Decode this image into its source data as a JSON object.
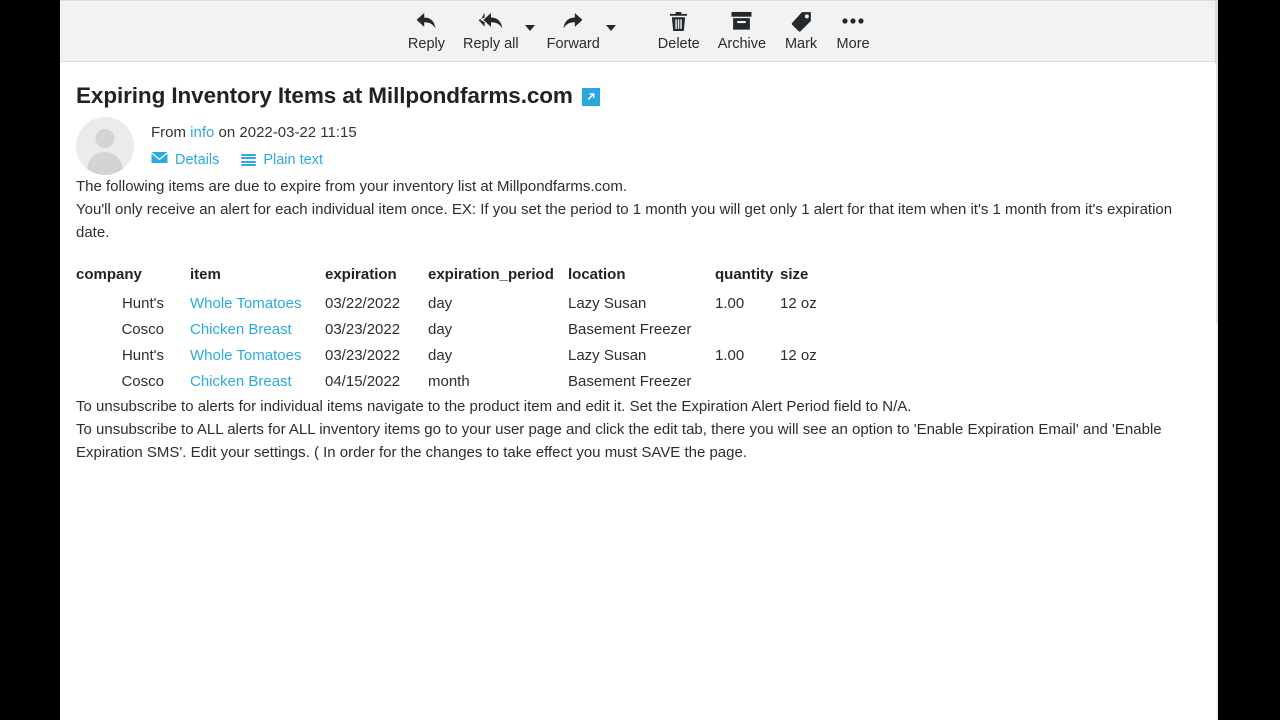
{
  "toolbar": {
    "buttons": [
      {
        "label": "Reply",
        "icon": "reply-icon",
        "caret": false
      },
      {
        "label": "Reply all",
        "icon": "reply-all-icon",
        "caret": true
      },
      {
        "label": "Forward",
        "icon": "forward-icon",
        "caret": true
      },
      {
        "label": "Delete",
        "icon": "trash-icon",
        "caret": false
      },
      {
        "label": "Archive",
        "icon": "archive-icon",
        "caret": false
      },
      {
        "label": "Mark",
        "icon": "tag-icon",
        "caret": false
      },
      {
        "label": "More",
        "icon": "ellipsis-icon",
        "caret": false
      }
    ]
  },
  "message": {
    "subject": "Expiring Inventory Items at Millpondfarms.com",
    "from_prefix": "From",
    "from_sender": "info",
    "from_middle": "on",
    "from_date": "2022-03-22 11:15",
    "details_label": "Details",
    "plain_text_label": "Plain text"
  },
  "body": {
    "paragraph_1": "The following items are due to expire from your inventory list at Millpondfarms.com.",
    "paragraph_2": "You'll only receive an alert for each individual item once. EX: If you set the period to 1 month you will get only 1 alert for that item when it's 1 month from it's expiration date.",
    "paragraph_3": "To unsubscribe to alerts for individual items navigate to the product item and edit it. Set the Expiration Alert Period field to N/A.",
    "paragraph_4": "To unsubscribe to ALL alerts for ALL inventory items go to your user page and click the edit tab, there you will see an option to 'Enable Expiration Email' and 'Enable Expiration SMS'. Edit your settings. ( In order for the changes to take effect you must SAVE the page."
  },
  "table": {
    "headers": [
      "company",
      "item",
      "expiration",
      "expiration_period",
      "location",
      "quantity",
      "size"
    ],
    "rows": [
      {
        "company": "Hunt's",
        "item": "Whole Tomatoes",
        "expiration": "03/22/2022",
        "expiration_period": "day",
        "location": "Lazy Susan",
        "quantity": "1.00",
        "size": "12 oz"
      },
      {
        "company": "Cosco",
        "item": "Chicken Breast",
        "expiration": "03/23/2022",
        "expiration_period": "day",
        "location": "Basement Freezer",
        "quantity": "",
        "size": ""
      },
      {
        "company": "Hunt's",
        "item": "Whole Tomatoes",
        "expiration": "03/23/2022",
        "expiration_period": "day",
        "location": "Lazy Susan",
        "quantity": "1.00",
        "size": "12 oz"
      },
      {
        "company": "Cosco",
        "item": "Chicken Breast",
        "expiration": "04/15/2022",
        "expiration_period": "month",
        "location": "Basement Freezer",
        "quantity": "",
        "size": ""
      }
    ]
  },
  "colors": {
    "link": "#2ca9e3",
    "toolbar_bg": "#f2f2f2",
    "text": "#2d2d2d",
    "accent_badge": "#29a8e0"
  }
}
